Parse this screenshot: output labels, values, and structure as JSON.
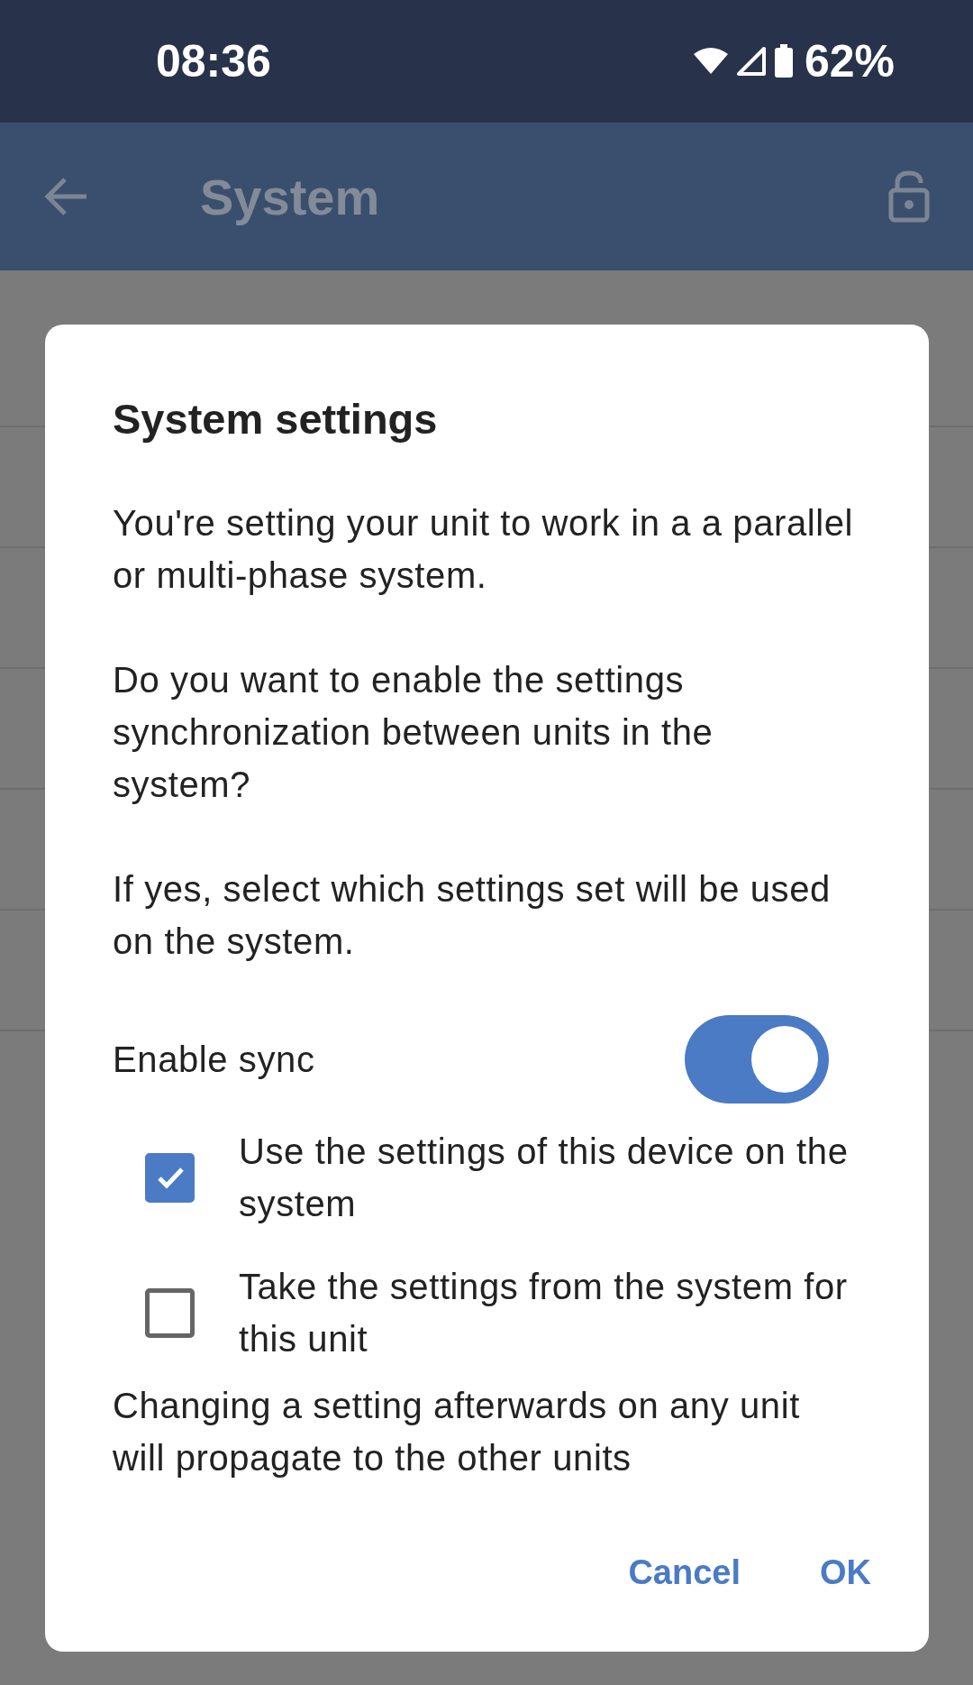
{
  "status_bar": {
    "time": "08:36",
    "battery": "62%"
  },
  "app_bar": {
    "title": "System"
  },
  "dialog": {
    "title": "System settings",
    "paragraphs": [
      "You're setting your unit to work in a a parallel or multi-phase system.",
      "Do you want to enable the settings synchronization between units in the system?",
      "If yes, select which settings set will be used on the system."
    ],
    "toggle": {
      "label": "Enable sync",
      "on": true
    },
    "options": [
      {
        "label": "Use the settings of this device on the system",
        "checked": true
      },
      {
        "label": "Take the settings from the system for this unit",
        "checked": false
      }
    ],
    "note": "Changing a setting afterwards on any unit will propagate to the other units",
    "buttons": [
      "Cancel",
      "OK"
    ]
  }
}
